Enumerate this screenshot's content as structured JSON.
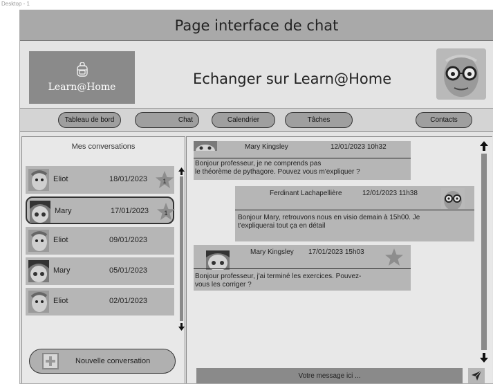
{
  "frame_label": "Desktop - 1",
  "page_title": "Page interface de chat",
  "logo_text": "Learn@Home",
  "header_title": "Echanger sur Learn@Home",
  "nav": {
    "dashboard": "Tableau de bord",
    "chat": "Chat",
    "calendar": "Calendrier",
    "tasks": "Tâches",
    "contacts": "Contacts"
  },
  "conversations": {
    "title": "Mes conversations",
    "items": [
      {
        "name": "Eliot",
        "date": "18/01/2023",
        "badge": "1"
      },
      {
        "name": "Mary",
        "date": "17/01/2023",
        "badge": "1"
      },
      {
        "name": "Eliot",
        "date": "09/01/2023"
      },
      {
        "name": "Mary",
        "date": "05/01/2023"
      },
      {
        "name": "Eliot",
        "date": "02/01/2023"
      }
    ],
    "new_button": "Nouvelle conversation"
  },
  "messages": [
    {
      "author": "Mary Kingsley",
      "datetime": "12/01/2023 10h32",
      "line1": "Bonjour professeur, je ne comprends pas",
      "line2": "le théorème de pythagore. Pouvez vous m'expliquer ?"
    },
    {
      "author": "Ferdinant Lachapellière",
      "datetime": "12/01/2023  11h38",
      "line1": "Bonjour Mary, retrouvons nous en visio demain à 15h00. Je",
      "line2": "t'expliquerai tout ça en détail"
    },
    {
      "author": "Mary Kingsley",
      "datetime": "17/01/2023  15h03",
      "line1": "Bonjour professeur, j'ai terminé les exercices. Pouvez-",
      "line2": "vous les corriger ?"
    }
  ],
  "input": {
    "placeholder": "Votre message ici ..."
  },
  "colors": {
    "title_bar": "#a9a9a9",
    "panel": "#e8e8e8",
    "item": "#b6b6b6",
    "input": "#8a8a8a"
  }
}
